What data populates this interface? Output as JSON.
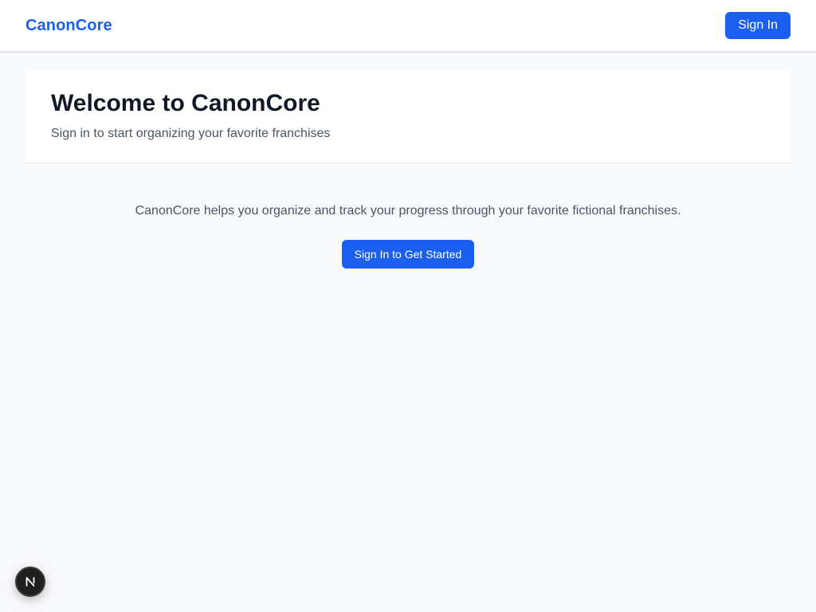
{
  "header": {
    "brand": "CanonCore",
    "signin_label": "Sign In"
  },
  "hero": {
    "title": "Welcome to CanonCore",
    "subtitle": "Sign in to start organizing your favorite franchises"
  },
  "main": {
    "description": "CanonCore helps you organize and track your progress through your favorite fictional franchises.",
    "cta_label": "Sign In to Get Started"
  },
  "devtools": {
    "icon": "nextjs-logo-icon",
    "glyph": "N"
  },
  "colors": {
    "accent": "#1a5ff0",
    "page_background": "#f8f9fb",
    "heading": "#111827",
    "muted_text": "#4b5563"
  }
}
